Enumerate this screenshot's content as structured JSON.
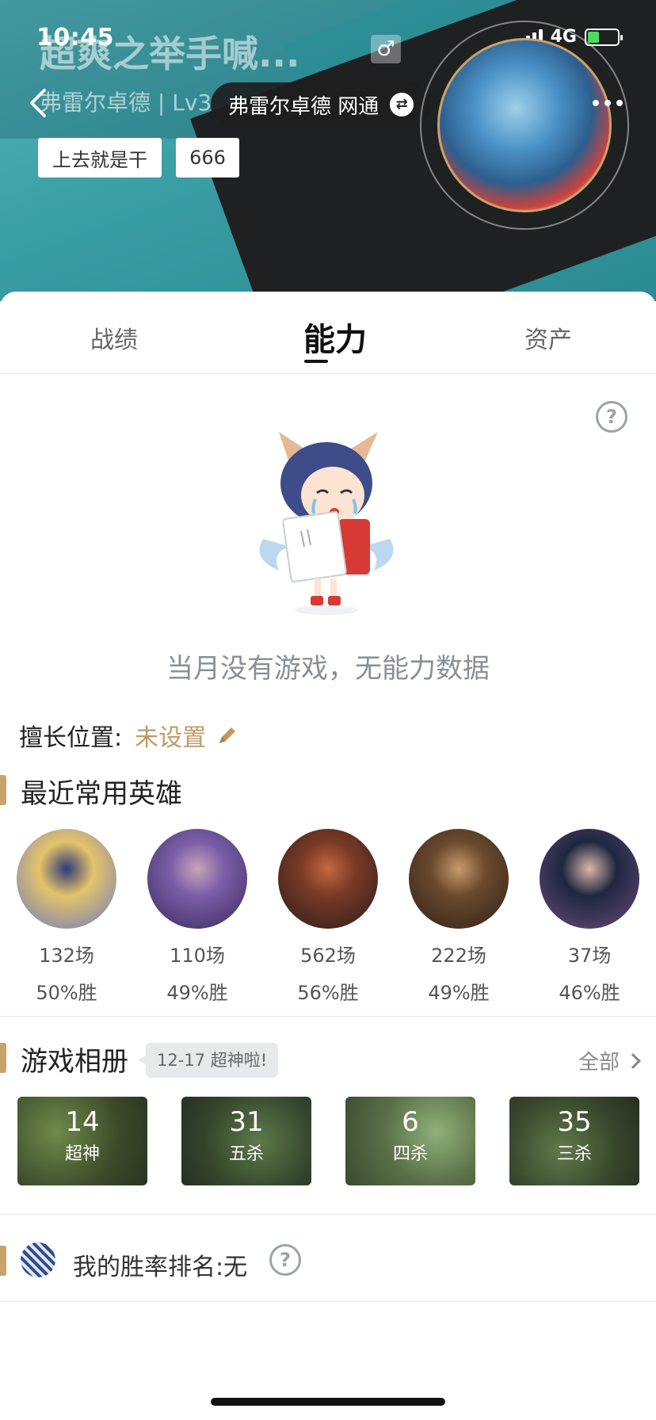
{
  "status_bar": {
    "time": "10:45",
    "network": "4G"
  },
  "header": {
    "title": "超爽之举手喊...",
    "gender_icon": "♂",
    "subtitle": "弗雷尔卓德 | Lv3",
    "server_pill": "弗雷尔卓德 网通",
    "tags": [
      "上去就是干",
      "666"
    ]
  },
  "tabs": [
    {
      "label": "战绩",
      "active": false
    },
    {
      "label": "能力",
      "active": true
    },
    {
      "label": "资产",
      "active": false
    }
  ],
  "empty_state": {
    "message": "当月没有游戏，无能力数据"
  },
  "position": {
    "label": "擅长位置:",
    "value": "未设置"
  },
  "recent_heroes": {
    "title": "最近常用英雄",
    "items": [
      {
        "games": "132场",
        "winrate": "50%胜",
        "colors": [
          "#e5c36a",
          "#6b79c0",
          "#2f3a78"
        ]
      },
      {
        "games": "110场",
        "winrate": "49%胜",
        "colors": [
          "#7a5ea8",
          "#3b2a5c",
          "#c9a5b6"
        ]
      },
      {
        "games": "562场",
        "winrate": "56%胜",
        "colors": [
          "#7a3a26",
          "#2a1c1c",
          "#c4693e"
        ]
      },
      {
        "games": "222场",
        "winrate": "49%胜",
        "colors": [
          "#6b4a2e",
          "#2f2016",
          "#c89b6c"
        ]
      },
      {
        "games": "37场",
        "winrate": "46%胜",
        "colors": [
          "#1f2740",
          "#6a4a7a",
          "#d9b8a8"
        ]
      }
    ]
  },
  "album": {
    "title": "游戏相册",
    "badge": "12-17 超神啦!",
    "all_label": "全部",
    "items": [
      {
        "count": "14",
        "label": "超神"
      },
      {
        "count": "31",
        "label": "五杀"
      },
      {
        "count": "6",
        "label": "四杀"
      },
      {
        "count": "35",
        "label": "三杀"
      }
    ]
  },
  "win_rank": {
    "text": "我的胜率排名:无"
  },
  "colors": {
    "accent_gold": "#caa26c",
    "header_teal": "#3a9ea5",
    "dark": "#1f2022"
  }
}
